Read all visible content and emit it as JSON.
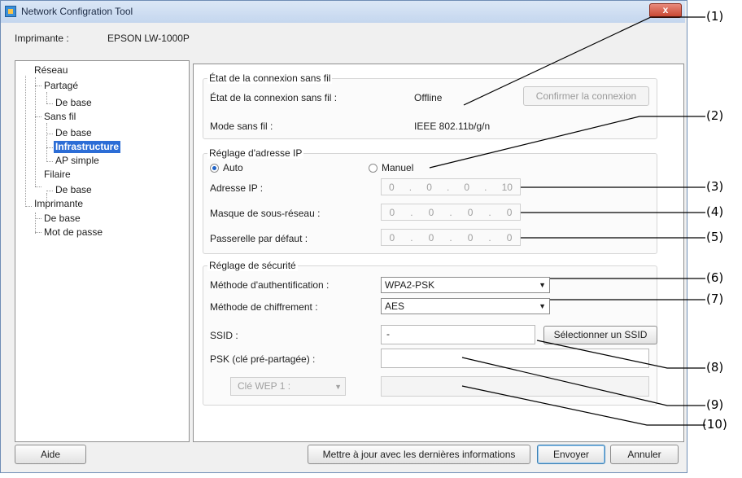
{
  "window": {
    "title": "Network Configration Tool",
    "close_label": "x"
  },
  "printer": {
    "label": "Imprimante :",
    "name": "EPSON LW-1000P"
  },
  "tree": {
    "reseau": "Réseau",
    "partage": "Partagé",
    "partage_base": "De base",
    "sans_fil": "Sans fil",
    "sans_fil_base": "De base",
    "infrastructure": "Infrastructure",
    "ap_simple": "AP simple",
    "filaire": "Filaire",
    "filaire_base": "De base",
    "imprimante": "Imprimante",
    "imprimante_base": "De base",
    "mot_de_passe": "Mot de passe"
  },
  "wireless_status": {
    "group_title": "État de la connexion sans fil",
    "status_label": "État de la connexion sans fil :",
    "status_value": "Offline",
    "confirm_button": "Confirmer la connexion",
    "mode_label": "Mode sans fil :",
    "mode_value": "IEEE 802.11b/g/n"
  },
  "ip_settings": {
    "group_title": "Réglage d'adresse IP",
    "auto_label": "Auto",
    "manual_label": "Manuel",
    "ip_label": "Adresse IP :",
    "ip_value": [
      "0",
      "0",
      "0",
      "10"
    ],
    "mask_label": "Masque de sous-réseau :",
    "mask_value": [
      "0",
      "0",
      "0",
      "0"
    ],
    "gateway_label": "Passerelle par défaut :",
    "gateway_value": [
      "0",
      "0",
      "0",
      "0"
    ],
    "dot": "."
  },
  "security": {
    "group_title": "Réglage de sécurité",
    "auth_label": "Méthode d'authentification :",
    "auth_value": "WPA2-PSK",
    "enc_label": "Méthode de chiffrement :",
    "enc_value": "AES",
    "ssid_label": "SSID :",
    "ssid_value": "-",
    "select_ssid_button": "Sélectionner un SSID",
    "psk_label": "PSK (clé pré-partagée) :",
    "psk_value": "",
    "wep_select": "Clé WEP 1 :",
    "wep_value": ""
  },
  "footer": {
    "help_button": "Aide",
    "update_button": "Mettre à jour avec les dernières informations",
    "send_button": "Envoyer",
    "cancel_button": "Annuler"
  },
  "callouts": [
    "(1)",
    "(2)",
    "(3)",
    "(4)",
    "(5)",
    "(6)",
    "(7)",
    "(8)",
    "(9)",
    "(10)"
  ],
  "icons": {
    "app": "network-app-icon",
    "close": "close-icon",
    "dropdown": "chevron-down-icon"
  },
  "colors": {
    "selection": "#2c6dd6",
    "title_bar": "#c4d6ee",
    "close": "#c7442f"
  }
}
